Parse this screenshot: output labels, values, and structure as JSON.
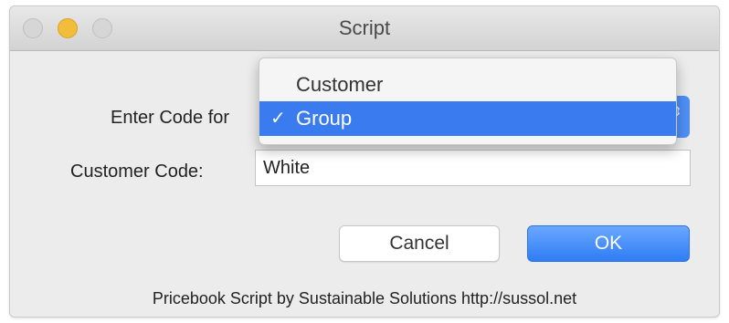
{
  "window": {
    "title": "Script",
    "controls": {
      "close_icon": "close-icon",
      "minimize_icon": "minimize-icon",
      "zoom_icon": "zoom-icon"
    }
  },
  "form": {
    "enter_code_label": "Enter Code for",
    "popup": {
      "selected_value": "Group",
      "stepper_glyph": "⇕"
    },
    "customer_code_label": "Customer Code:",
    "customer_code_value": "White"
  },
  "menu": {
    "items": [
      {
        "label": "Customer",
        "checked": false
      },
      {
        "label": "Group",
        "checked": true
      }
    ],
    "check_glyph": "✓"
  },
  "buttons": {
    "cancel_label": "Cancel",
    "ok_label": "OK"
  },
  "footer": {
    "text": "Pricebook Script by Sustainable Solutions http://sussol.net"
  },
  "colors": {
    "accent": "#3a7cf0",
    "ok_button": "#4f8ff7",
    "minimize_button": "#f1bd3a"
  }
}
